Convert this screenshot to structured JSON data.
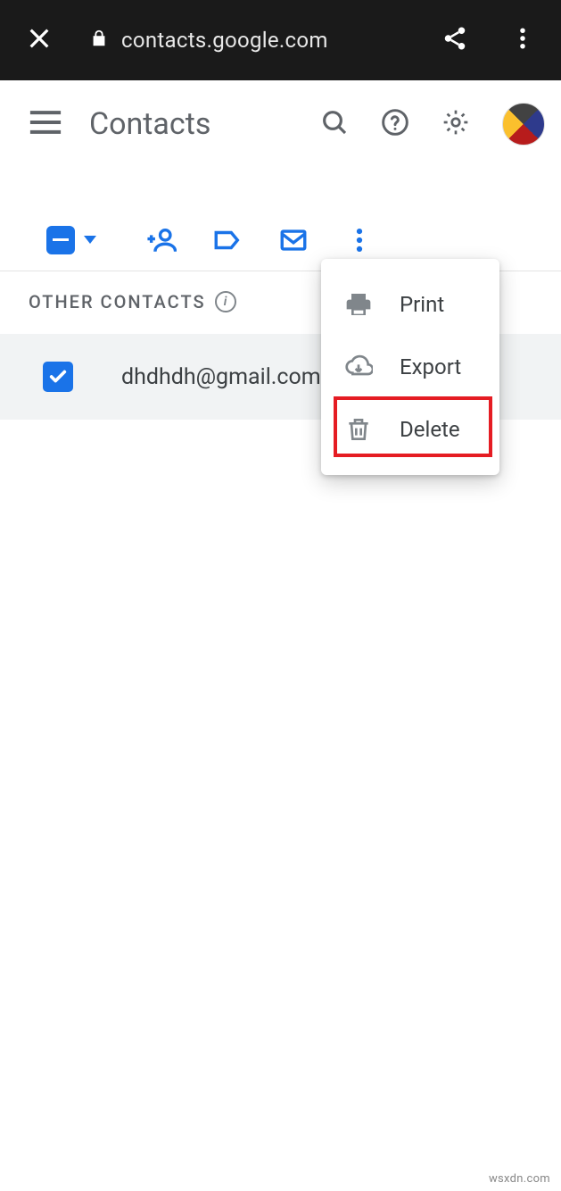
{
  "browser": {
    "url": "contacts.google.com"
  },
  "app": {
    "title": "Contacts"
  },
  "section": {
    "header": "OTHER CONTACTS"
  },
  "contact": {
    "email": "dhdhdh@gmail.com"
  },
  "popup": {
    "items": [
      {
        "label": "Print"
      },
      {
        "label": "Export"
      },
      {
        "label": "Delete"
      }
    ]
  },
  "watermark": "wsxdn.com"
}
